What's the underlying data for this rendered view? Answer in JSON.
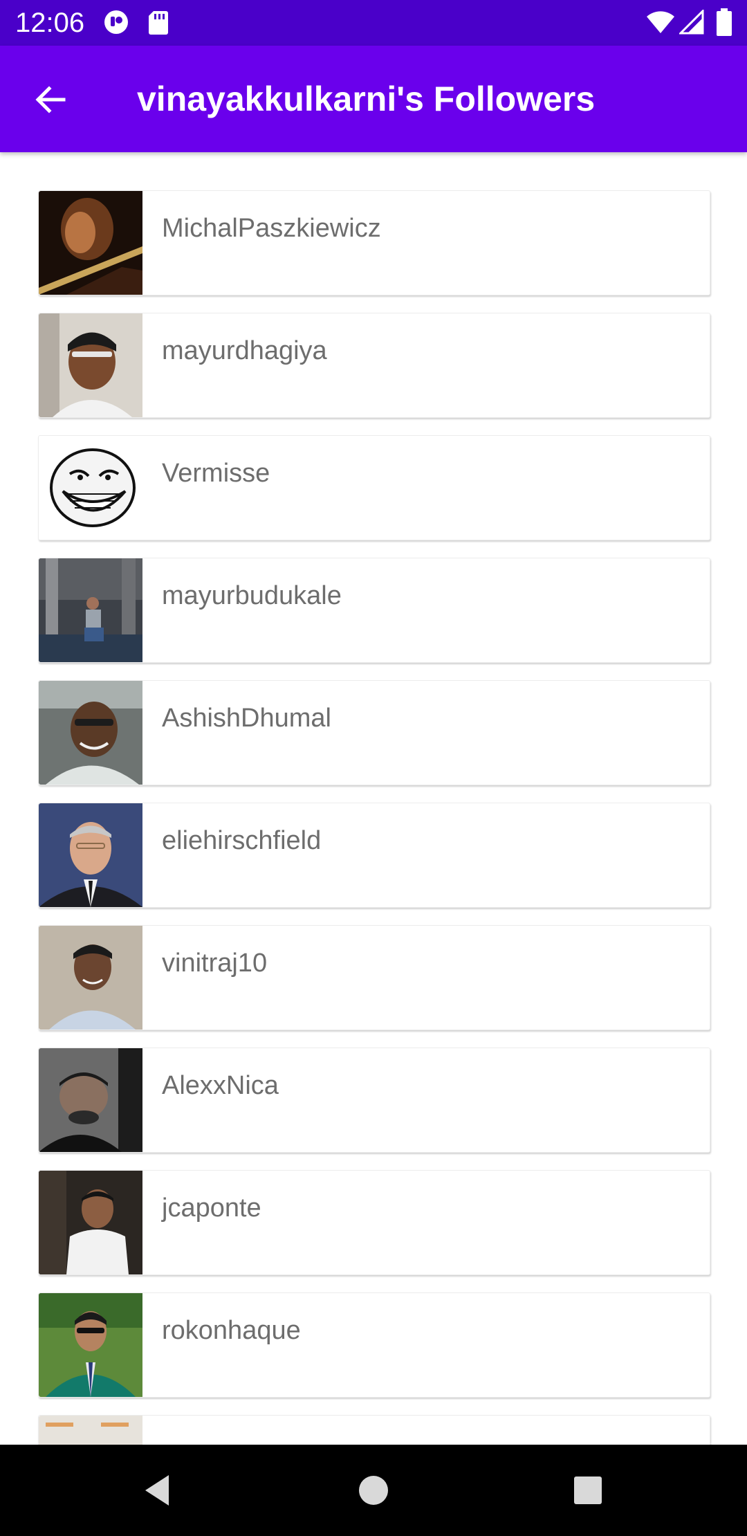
{
  "status_bar": {
    "time": "12:06",
    "icons": [
      "notification-app-icon",
      "sd-card-icon",
      "wifi-icon",
      "cell-signal-icon",
      "battery-icon"
    ]
  },
  "app_bar": {
    "title": "vinayakkulkarni's Followers",
    "back_icon": "arrow-back-icon",
    "color": "#6a00ec",
    "status_color": "#4a00c9"
  },
  "followers": [
    {
      "name": "MichalPaszkiewicz"
    },
    {
      "name": "mayurdhagiya"
    },
    {
      "name": "Vermisse"
    },
    {
      "name": "mayurbudukale"
    },
    {
      "name": "AshishDhumal"
    },
    {
      "name": "eliehirschfield"
    },
    {
      "name": "vinitraj10"
    },
    {
      "name": "AlexxNica"
    },
    {
      "name": "jcaponte"
    },
    {
      "name": "rokonhaque"
    }
  ],
  "nav_bar": {
    "icons": [
      "back-triangle-icon",
      "home-circle-icon",
      "recents-square-icon"
    ]
  }
}
